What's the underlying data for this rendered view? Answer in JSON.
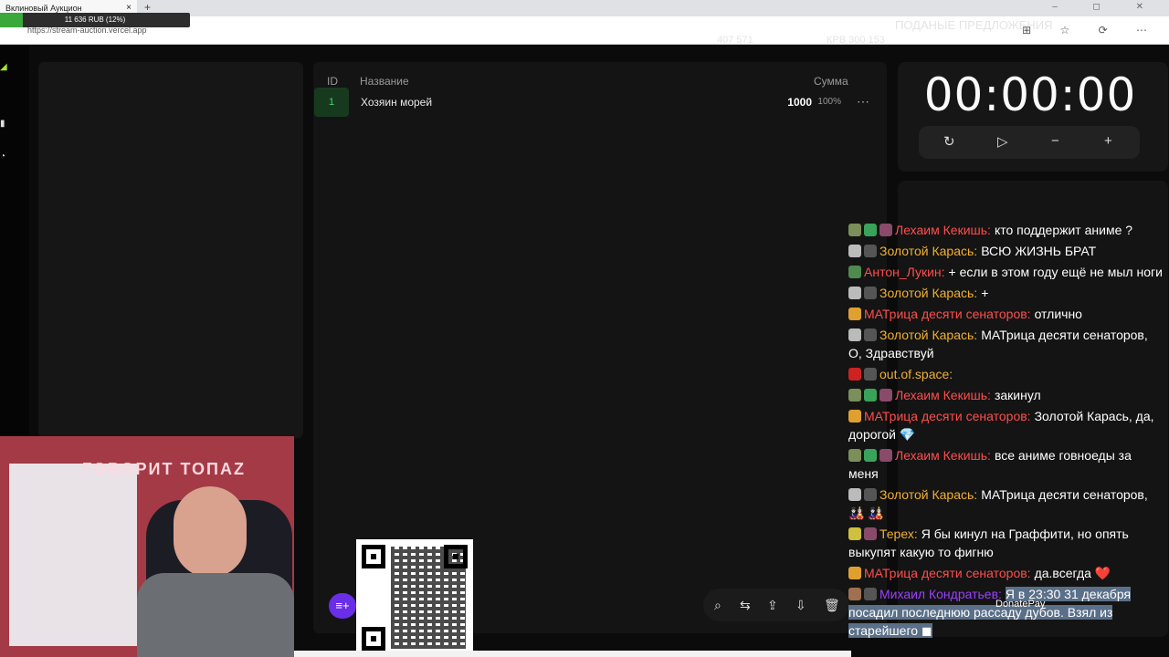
{
  "browser": {
    "tab_title": "Вклиновый Аукцион",
    "tab_close": "×",
    "new_tab": "+",
    "url": "https://stream-auction.vercel.app",
    "window_controls": "– ◻ ✕",
    "toolbar_icons": "⊞ ☆ ⟳ ⋯",
    "faint_overlay": [
      "407 571",
      "КРВ 300 153",
      "ПОДАНЫЕ ПРЕДЛОЖЕНИЯ"
    ]
  },
  "donation_bar": {
    "text": "11 636 RUB (12%)",
    "percent": 12,
    "fill_color": "#3aa83a"
  },
  "table": {
    "headers": {
      "id": "ID",
      "name": "Название",
      "sum": "Сумма"
    },
    "rows": [
      {
        "id": "1",
        "name": "Хозяин морей",
        "sum": "1000",
        "percent": "100%",
        "menu": "⋯"
      }
    ]
  },
  "bottom_toolbar": {
    "icons": [
      "search-icon",
      "swap-icon",
      "upload-icon",
      "download-icon",
      "trash-icon"
    ],
    "glyphs": [
      "⌕",
      "⇆",
      "⇪",
      "⇩",
      "🗑"
    ]
  },
  "add_button_glyph": "≡+",
  "timer": {
    "display": "00:00:00",
    "controls": [
      "↻",
      "▷",
      "−",
      "+"
    ]
  },
  "chat": {
    "messages": [
      {
        "nick": "Лехаим Кекишь:",
        "color": "#ff4d4d",
        "text": "кто поддержит аниме ?",
        "badges": [
          "#7a8f5a",
          "#3aa35a",
          "#8a4a6a"
        ]
      },
      {
        "nick": "Золотой Карась:",
        "color": "#f0b030",
        "text": "ВСЮ ЖИЗНЬ БРАТ",
        "badges": [
          "#bbbbbb",
          "#555555"
        ]
      },
      {
        "nick": "Антон_Лукин:",
        "color": "#ff4d4d",
        "text": "+ если в этом году ещё не мыл ноги",
        "badges": [
          "#4f8a4f"
        ]
      },
      {
        "nick": "Золотой Карась:",
        "color": "#f0b030",
        "text": "+",
        "badges": [
          "#bbbbbb",
          "#555555"
        ]
      },
      {
        "nick": "МАТрица десяти сенаторов:",
        "color": "#ff4d4d",
        "text": "отлично",
        "badges": [
          "#e0a030"
        ]
      },
      {
        "nick": "Золотой Карась:",
        "color": "#f0b030",
        "text": "МАТрица десяти сенаторов, О, Здравствуй",
        "badges": [
          "#bbbbbb",
          "#555555"
        ]
      },
      {
        "nick": "out.of.space:",
        "color": "#f0b030",
        "text": "",
        "badges": [
          "#cc2222",
          "#555555"
        ]
      },
      {
        "nick": "Лехаим Кекишь:",
        "color": "#ff4d4d",
        "text": "закинул",
        "badges": [
          "#7a8f5a",
          "#3aa35a",
          "#8a4a6a"
        ]
      },
      {
        "nick": "МАТрица десяти сенаторов:",
        "color": "#ff4d4d",
        "text": "Золотой Карась, да, дорогой 💎",
        "badges": [
          "#e0a030"
        ]
      },
      {
        "nick": "Лехаим Кекишь:",
        "color": "#ff4d4d",
        "text": "все аниме говноеды за меня",
        "badges": [
          "#7a8f5a",
          "#3aa35a",
          "#8a4a6a"
        ]
      },
      {
        "nick": "Золотой Карась:",
        "color": "#f0b030",
        "text": "МАТрица десяти сенаторов, 🎎 🎎",
        "badges": [
          "#bbbbbb",
          "#555555"
        ]
      },
      {
        "nick": "Терех:",
        "color": "#f0b030",
        "text": "Я бы кинул на Граффити, но опять выкупят какую то фигню",
        "badges": [
          "#d0c040",
          "#8a4a6a"
        ]
      },
      {
        "nick": "МАТрица десяти сенаторов:",
        "color": "#ff4d4d",
        "text": "да.всегда ❤️",
        "badges": [
          "#e0a030"
        ]
      },
      {
        "nick": "Михаил Кондратьев:",
        "color": "#9b40ff",
        "text": "Я в 23:30 31 декабря посадил последнюю рассаду дубов. Взял из старейшего ◼",
        "badges": [
          "#a07050",
          "#555555"
        ],
        "highlight": true
      }
    ]
  },
  "webcam": {
    "neon_sign": "ГОВОРИТ ТОПАZ"
  },
  "donatepay_label": "DonatePay"
}
